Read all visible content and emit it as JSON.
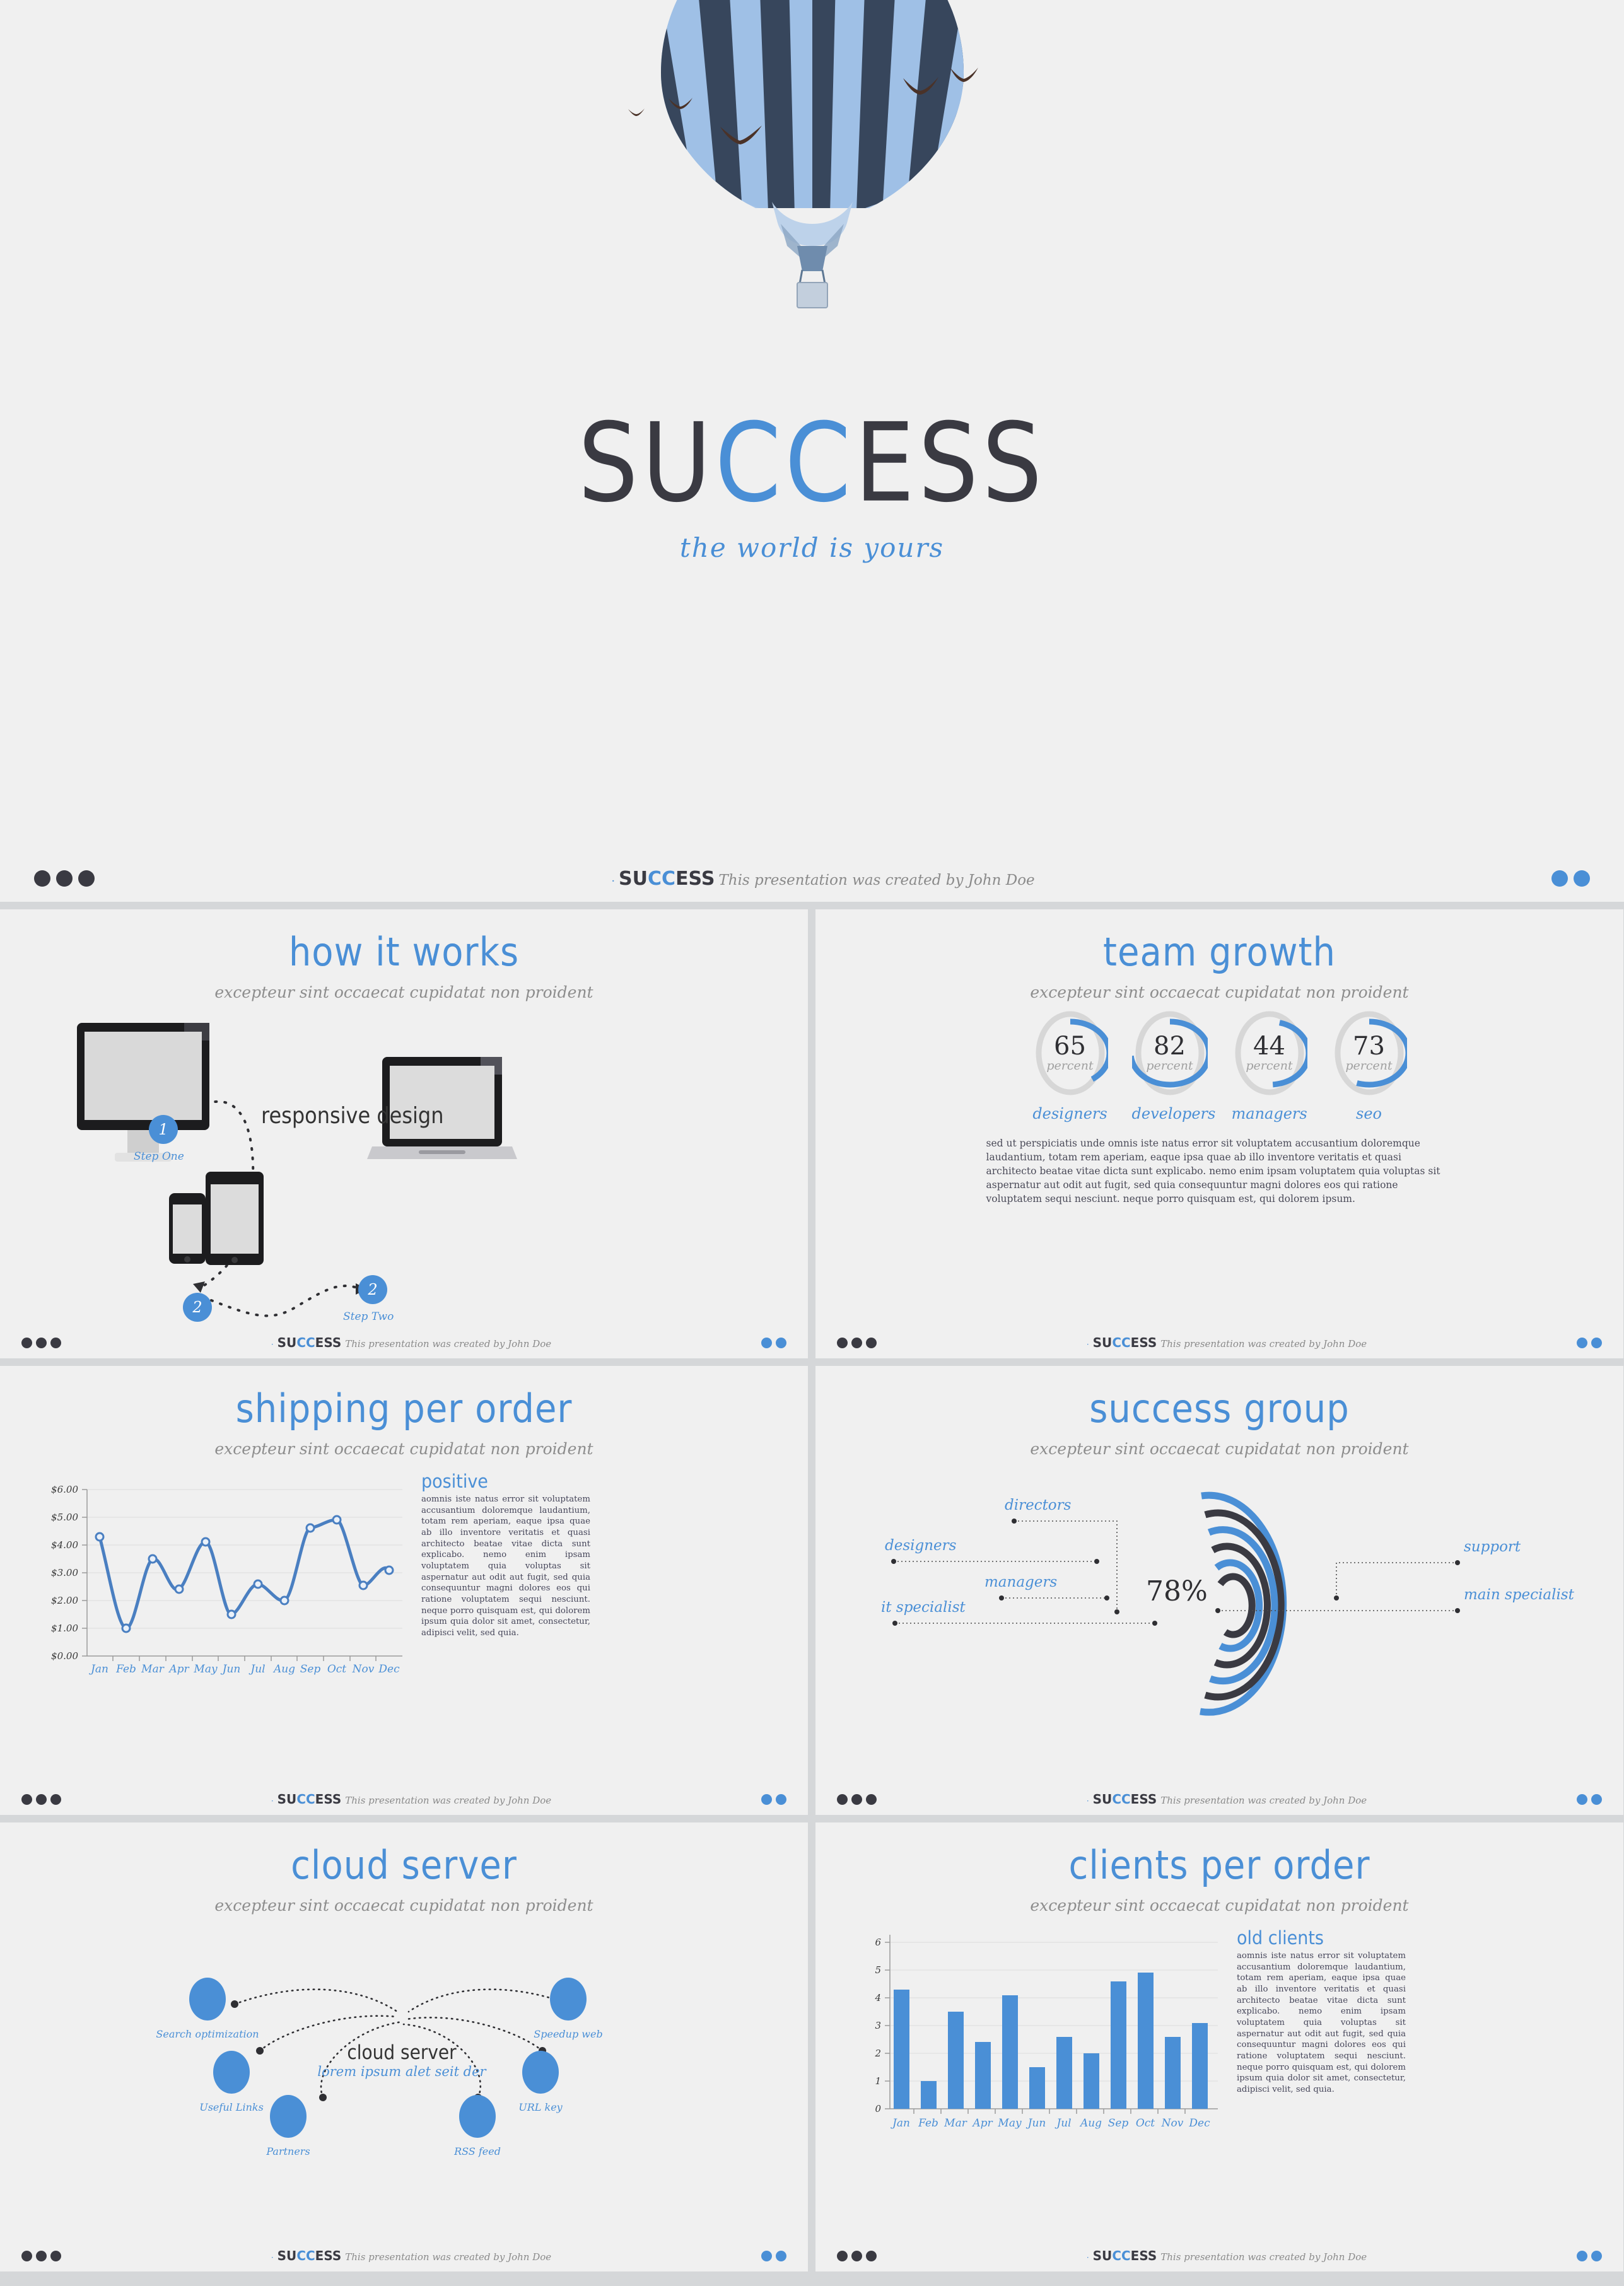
{
  "brand": {
    "name_part1": "SU",
    "name_cc": "CC",
    "name_part3": "ESS",
    "tagline": "the world is yours",
    "accent_color": "#4a8fd6",
    "dark_color": "#3a3a42"
  },
  "footer": {
    "bullet": "·",
    "logo_p1": "SU",
    "logo_cc": "CC",
    "logo_p3": "ESS",
    "text": "This presentation was created by John Doe"
  },
  "common": {
    "subtitle": "excepteur sint occaecat cupidatat non proident",
    "lorem_long": "sed ut perspiciatis unde omnis iste natus error sit voluptatem accusantium doloremque laudantium, totam rem aperiam, eaque ipsa quae ab illo inventore veritatis et quasi architecto beatae vitae dicta sunt explicabo. nemo enim ipsam voluptatem quia voluptas sit aspernatur aut odit aut fugit, sed quia consequuntur magni dolores eos qui ratione voluptatem sequi nesciunt. neque porro quisquam est, qui dolorem ipsum.",
    "lorem_side": "aomnis iste natus error sit voluptatem accusantium doloremque laudantium, totam rem aperiam, eaque ipsa quae ab illo inventore veritatis et quasi architecto beatae vitae dicta sunt explicabo. nemo enim ipsam voluptatem quia voluptas sit aspernatur aut odit aut fugit, sed quia consequuntur magni dolores eos qui ratione voluptatem sequi nesciunt. neque porro quisquam est, qui dolorem ipsum quia dolor sit amet, consectetur, adipisci velit, sed quia."
  },
  "slides": {
    "how_it_works": {
      "title": "how it works",
      "responsive_label": "responsive design",
      "steps": [
        {
          "num": "1",
          "label": "Step One"
        },
        {
          "num": "2",
          "label": "Step Two"
        },
        {
          "num": "2",
          "label": "Step Two"
        }
      ]
    },
    "team_growth": {
      "title": "team growth",
      "gauges": [
        {
          "value": "65",
          "unit": "percent",
          "label": "designers",
          "pct": 65
        },
        {
          "value": "82",
          "unit": "percent",
          "label": "developers",
          "pct": 82
        },
        {
          "value": "44",
          "unit": "percent",
          "label": "managers",
          "pct": 44
        },
        {
          "value": "73",
          "unit": "percent",
          "label": "seo",
          "pct": 73
        }
      ]
    },
    "shipping": {
      "title": "shipping per order",
      "side_heading": "positive"
    },
    "success_group": {
      "title": "success group",
      "center_value": "78%",
      "labels_left": [
        "directors",
        "designers",
        "managers",
        "it specialist"
      ],
      "labels_right": [
        "support",
        "main specialist"
      ]
    },
    "cloud_server": {
      "title": "cloud server",
      "center_main": "cloud server",
      "center_sub": "lorem ipsum alet seit der",
      "nodes": [
        {
          "label": "Search optimization"
        },
        {
          "label": "Useful Links"
        },
        {
          "label": "Partners"
        },
        {
          "label": "RSS feed"
        },
        {
          "label": "URL key"
        },
        {
          "label": "Speedup web"
        }
      ]
    },
    "clients": {
      "title": "clients per order",
      "side_heading": "old clients"
    }
  },
  "chart_data": [
    {
      "type": "line",
      "title": "shipping per order",
      "categories": [
        "Jan",
        "Feb",
        "Mar",
        "Apr",
        "May",
        "Jun",
        "Jul",
        "Aug",
        "Sep",
        "Oct",
        "Nov",
        "Dec"
      ],
      "values": [
        4.3,
        1.0,
        3.5,
        2.4,
        4.1,
        1.5,
        2.6,
        2.0,
        4.6,
        4.9,
        2.6,
        3.1
      ],
      "ytick_labels": [
        "$0.00",
        "$1.00",
        "$2.00",
        "$3.00",
        "$4.00",
        "$5.00",
        "$6.00"
      ],
      "ylim": [
        0,
        6
      ],
      "xlabel": "",
      "ylabel": "",
      "grid": true,
      "legend": "none",
      "series_color": "#4a7fc1",
      "marker": "open-circle"
    },
    {
      "type": "bar",
      "title": "clients per order",
      "categories": [
        "Jan",
        "Feb",
        "Mar",
        "Apr",
        "May",
        "Jun",
        "Jul",
        "Aug",
        "Sep",
        "Oct",
        "Nov",
        "Dec"
      ],
      "values": [
        4.3,
        1.0,
        3.5,
        2.4,
        4.1,
        1.5,
        2.6,
        2.0,
        4.6,
        4.9,
        2.6,
        3.1
      ],
      "ytick_labels": [
        "0",
        "1",
        "2",
        "3",
        "4",
        "5",
        "6"
      ],
      "ylim": [
        0,
        6
      ],
      "xlabel": "",
      "ylabel": "",
      "grid": true,
      "legend": "none",
      "series_color": "#4a8fd6"
    },
    {
      "type": "pie",
      "title": "success group",
      "center_label": "78%",
      "slices": [
        {
          "name": "directors",
          "color": "#4a8fd6"
        },
        {
          "name": "designers",
          "color": "#4a8fd6"
        },
        {
          "name": "managers",
          "color": "#3a3a42"
        },
        {
          "name": "it specialist",
          "color": "#3a3a42"
        },
        {
          "name": "support",
          "color": "#4a8fd6"
        },
        {
          "name": "main specialist",
          "color": "#3a3a42"
        }
      ]
    },
    {
      "type": "bar",
      "title": "team growth",
      "categories": [
        "designers",
        "developers",
        "managers",
        "seo"
      ],
      "values": [
        65,
        82,
        44,
        73
      ],
      "ylim": [
        0,
        100
      ],
      "unit": "percent",
      "grid": false,
      "legend": "none",
      "series_color": "#4a8fd6"
    }
  ]
}
